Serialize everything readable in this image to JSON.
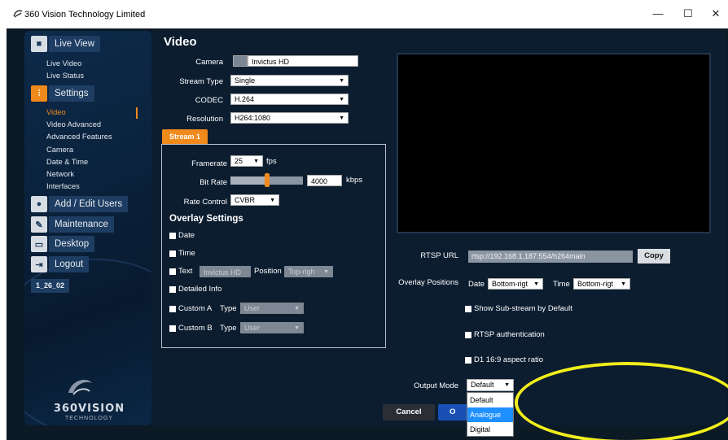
{
  "window": {
    "title": "360 Vision Technology Limited",
    "minimize": "—",
    "maximize": "☐",
    "close": "✕"
  },
  "sidebar": {
    "live_view": "Live View",
    "live_video": "Live Video",
    "live_status": "Live Status",
    "settings": "Settings",
    "settings_items": [
      "Video",
      "Video Advanced",
      "Advanced Features",
      "Camera",
      "Date & Time",
      "Network",
      "Interfaces"
    ],
    "add_edit_users": "Add / Edit Users",
    "maintenance": "Maintenance",
    "desktop": "Desktop",
    "logout": "Logout",
    "version": "1_26_02",
    "brand": "360VISION",
    "brand_sub": "TECHNOLOGY"
  },
  "video": {
    "title": "Video",
    "camera_label": "Camera",
    "camera_value": "Invictus HD",
    "stream_type_label": "Stream Type",
    "stream_type_value": "Single",
    "codec_label": "CODEC",
    "codec_value": "H.264",
    "resolution_label": "Resolution",
    "resolution_value": "H264:1080"
  },
  "stream": {
    "tab": "Stream 1",
    "framerate_label": "Framerate",
    "framerate_value": "25",
    "fps_unit": "fps",
    "bitrate_label": "Bit Rate",
    "bitrate_value": "4000",
    "bitrate_unit": "kbps",
    "bitrate_slider_fraction": 0.5,
    "rate_control_label": "Rate Control",
    "rate_control_value": "CVBR"
  },
  "overlay": {
    "title": "Overlay Settings",
    "date": "Date",
    "time": "Time",
    "text": "Text",
    "text_value": "Invictus HD",
    "position_label": "Position",
    "position_value": "Top-righ",
    "detailed_info": "Detailed Info",
    "custom_a": "Custom A",
    "custom_b": "Custom B",
    "type_label": "Type",
    "type_value": "User"
  },
  "rtsp": {
    "label": "RTSP URL",
    "url": "rtsp://192.168.1.187:554/h264main",
    "copy": "Copy"
  },
  "overlay_positions": {
    "label": "Overlay Positions",
    "date_label": "Date",
    "date_value": "Bottom-rigt",
    "time_label": "Time",
    "time_value": "Bottom-rigt"
  },
  "options": {
    "show_substream": "Show Sub-stream by Default",
    "rtsp_auth": "RTSP authentication",
    "d1_aspect": "D1 16:9 aspect ratio"
  },
  "output_mode": {
    "label": "Output Mode",
    "value": "Default",
    "options": [
      "Default",
      "Analogue",
      "Digital"
    ],
    "highlighted": "Analogue"
  },
  "buttons": {
    "cancel": "Cancel",
    "ok": "O"
  },
  "colors": {
    "accent": "#f08a1c",
    "annotation": "#f1ee1b"
  }
}
